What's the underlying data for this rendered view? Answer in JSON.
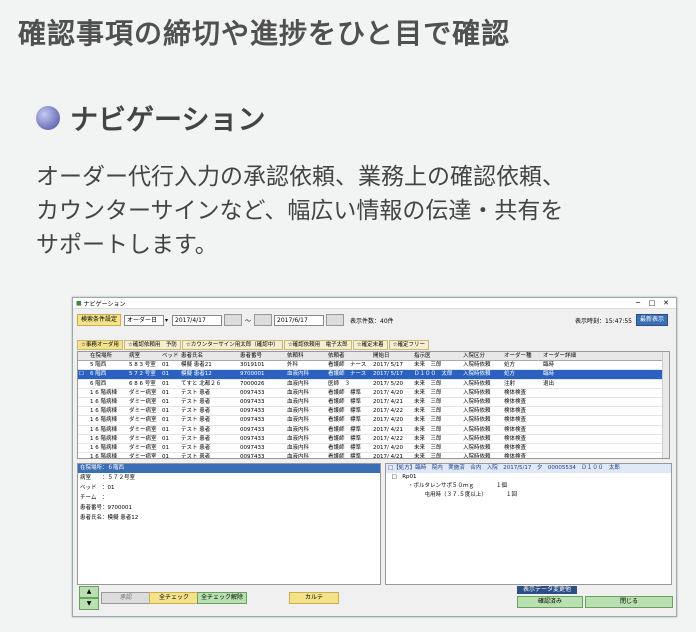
{
  "page": {
    "title": "確認事項の締切や進捗をひと目で確認",
    "section": "ナビゲーション",
    "desc": [
      "オーダー代行入力の承認依頼、業務上の確認依頼、",
      "カウンターサインなど、幅広い情報の伝達・共有を",
      "サポートします。"
    ]
  },
  "window": {
    "title": "ナビゲーション",
    "controls": [
      "─",
      "□",
      "✕"
    ],
    "toolbar": {
      "cond_btn": "検索条件設定",
      "type_select": "オーダー日",
      "from_date": "2017/4/17",
      "tilde": "～",
      "to_date": "2017/6/17",
      "count": "表示件数：40件",
      "time": "表示時刻：15:47:55",
      "refresh": "最新表示"
    },
    "tabs": [
      "☆事務オーダ用",
      "☆確認依頼用　予防",
      "☆カウンターサイン用太郎（確認中）",
      "☆確認依頼用　電子太郎",
      "☆確定未着",
      "☆確定フリー"
    ],
    "columns": [
      "",
      "在院場所",
      "病室",
      "ベッド",
      "患者氏名",
      "患者番号",
      "依頼科",
      "依頼者",
      "開始日",
      "指示医",
      "入院区分",
      "オーダー種",
      "オーダー詳細"
    ],
    "rows": [
      [
        "",
        "5 階西",
        "5 8 3 号室",
        "01",
        "模擬 患者21",
        "3019101",
        "外科",
        "看護師　ナース",
        "2017/ 5/17",
        "未来　三郎",
        "入院時依頼",
        "処方",
        "臨時"
      ],
      [
        "☐",
        "6 階西",
        "5 7 2 号室",
        "01",
        "模擬 患者12",
        "9700001",
        "血液内科",
        "看護師　ナース",
        "2017/ 5/17",
        "Ｄ１００　太郎",
        "入院時依頼",
        "処方",
        "臨時"
      ],
      [
        "",
        "6 階西",
        "6 8 6 号室",
        "01",
        "てすと 北都２６",
        "7000026",
        "血液内科",
        "医師　３",
        "2017/ 5/20",
        "未来　三郎",
        "入院時依頼",
        "注射",
        "退出"
      ],
      [
        "",
        "1 6 階病棟",
        "ダミー病室",
        "01",
        "テスト 患者",
        "0097433",
        "血液内科",
        "看護師　標準",
        "2017/ 4/20",
        "未来　三郎",
        "入院時依頼",
        "検体検査",
        ""
      ],
      [
        "",
        "1 6 階病棟",
        "ダミー病室",
        "01",
        "テスト 患者",
        "0097433",
        "血液内科",
        "看護師　標準",
        "2017/ 4/21",
        "未来　三郎",
        "入院時依頼",
        "検体検査",
        ""
      ],
      [
        "",
        "1 6 階病棟",
        "ダミー病室",
        "01",
        "テスト 患者",
        "0097433",
        "血液内科",
        "看護師　標準",
        "2017/ 4/22",
        "未来　三郎",
        "入院時依頼",
        "検体検査",
        ""
      ],
      [
        "",
        "1 6 階病棟",
        "ダミー病室",
        "01",
        "テスト 患者",
        "0097433",
        "血液内科",
        "看護師　標準",
        "2017/ 4/20",
        "未来　三郎",
        "入院時依頼",
        "検体検査",
        ""
      ],
      [
        "",
        "1 6 階病棟",
        "ダミー病室",
        "01",
        "テスト 患者",
        "0097433",
        "血液内科",
        "看護師　標準",
        "2017/ 4/21",
        "未来　三郎",
        "入院時依頼",
        "検体検査",
        ""
      ],
      [
        "",
        "1 6 階病棟",
        "ダミー病室",
        "01",
        "テスト 患者",
        "0097433",
        "血液内科",
        "看護師　標準",
        "2017/ 4/22",
        "未来　三郎",
        "入院時依頼",
        "検体検査",
        ""
      ],
      [
        "",
        "1 6 階病棟",
        "ダミー病室",
        "01",
        "テスト 患者",
        "0097433",
        "血液内科",
        "看護師　標準",
        "2017/ 4/20",
        "未来　三郎",
        "入院時依頼",
        "検体検査",
        ""
      ],
      [
        "",
        "1 6 階病棟",
        "ダミー病室",
        "01",
        "テスト 患者",
        "0097433",
        "血液内科",
        "看護師　標準",
        "2017/ 4/21",
        "未来　三郎",
        "入院時依頼",
        "検体検査",
        ""
      ]
    ],
    "left_pane": {
      "header": "在院場所：６階西",
      "lines": [
        "病室　　：５７２号室",
        "ベッド　：01",
        "チーム　：",
        "患者番号：9700001",
        "患者氏名：模擬 患者12"
      ]
    },
    "right_pane": {
      "header": "□【処方】臨時　院内　実施済　合内　入院　2017/5/17　夕　00005534　Ｄ１００　太郎",
      "lines": [
        "　□　Rp01",
        "　　　　・ボルタレンサポ５０ｍｇ　　　　１個",
        "　　　　　　　屯用時（３７.５度以上）　　　　１回"
      ]
    },
    "bottom": {
      "up": "▲",
      "down": "▼",
      "approve": "承認",
      "check": "全チェック",
      "uncheck": "全チェック解除",
      "chart": "カルテ",
      "display_label": "表示データ変更他",
      "done": "確認済み",
      "close": "閉じる"
    }
  }
}
